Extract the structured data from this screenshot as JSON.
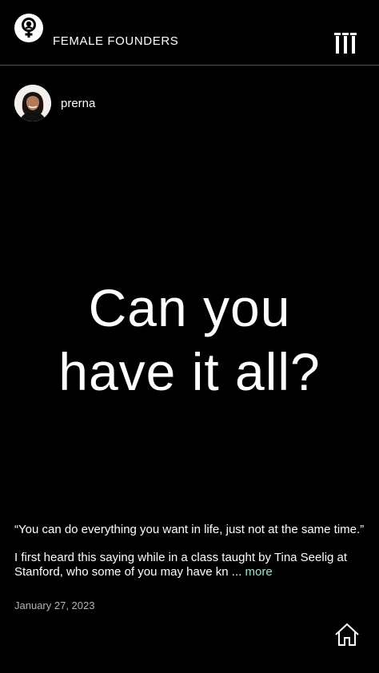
{
  "header": {
    "brand_name": "FEMALE FOUNDERS",
    "logo_icon": "female-symbol-icon",
    "menu_icon": "menu-bars-icon"
  },
  "author": {
    "name": "prerna",
    "avatar_icon": "profile-photo"
  },
  "post": {
    "title_line1": "Can you",
    "title_line2": "have it all?",
    "quote": "“You can do everything you want in life, just not at the same time.”",
    "excerpt": "I first heard this saying while in a class taught by Tina Seelig at Stanford, who some of you may have kn ...",
    "more_label": "more",
    "date": "January 27, 2023"
  },
  "footer": {
    "home_icon": "home-icon"
  },
  "colors": {
    "background": "#000000",
    "text": "#ffffff",
    "more_link": "#9be7c4",
    "date": "#b3b3b3",
    "divider": "#555555"
  }
}
